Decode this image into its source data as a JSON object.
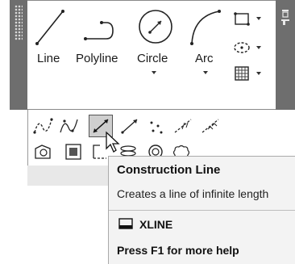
{
  "draw_panel": {
    "tools": [
      {
        "label": "Line",
        "icon": "line-icon"
      },
      {
        "label": "Polyline",
        "icon": "polyline-icon"
      },
      {
        "label": "Circle",
        "icon": "circle-icon"
      },
      {
        "label": "Arc",
        "icon": "arc-icon"
      }
    ],
    "side_tools": [
      "rectangle-icon",
      "ellipse-icon",
      "hatch-icon"
    ],
    "expanded_tools_row1": [
      "spline-fit-icon",
      "spline-cv-icon",
      "construction-line-icon",
      "ray-icon",
      "multiple-points-icon",
      "divide-icon",
      "measure-icon"
    ],
    "expanded_tools_row2": [
      "region-icon",
      "wipeout-icon",
      "boundary-icon",
      "helix-icon",
      "donut-icon",
      "revision-cloud-icon"
    ]
  },
  "tooltip": {
    "title": "Construction Line",
    "description": "Creates a line of infinite length",
    "command": "XLINE",
    "help": "Press F1 for more help"
  }
}
